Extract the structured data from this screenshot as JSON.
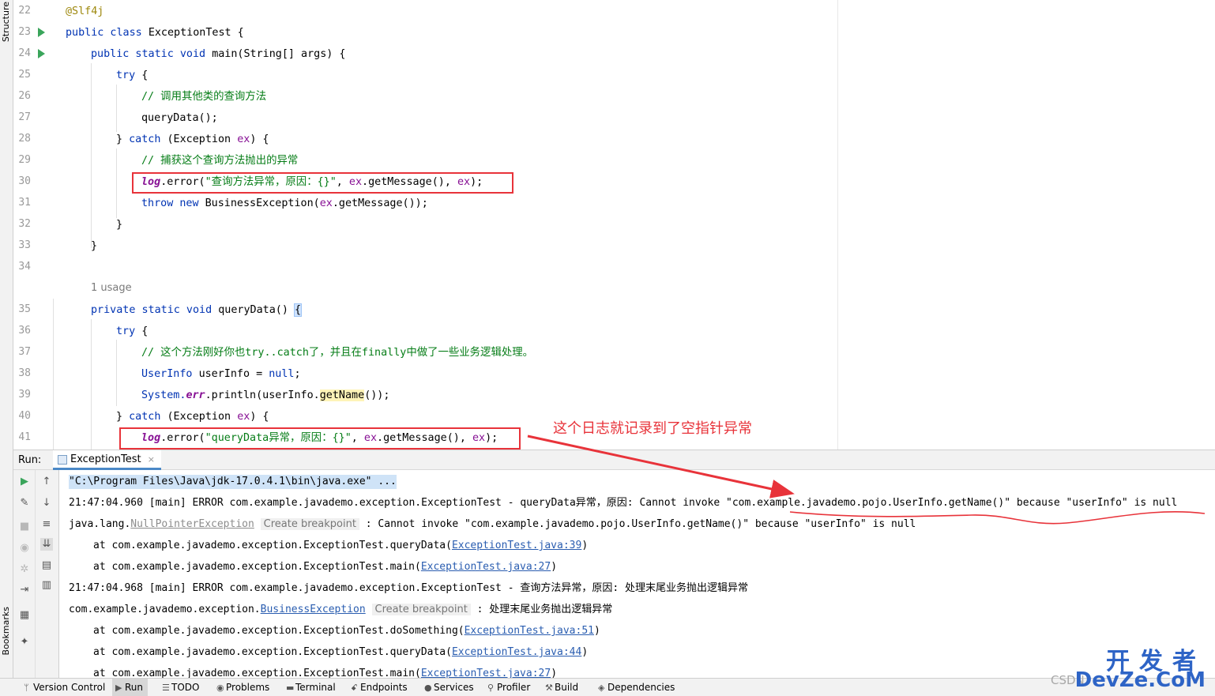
{
  "side_labels": {
    "structure": "Structure",
    "bookmarks": "Bookmarks"
  },
  "editor": {
    "line_numbers": [
      "22",
      "23",
      "24",
      "25",
      "26",
      "27",
      "28",
      "29",
      "30",
      "31",
      "32",
      "33",
      "34",
      "35",
      "36",
      "37",
      "38",
      "39",
      "40",
      "41"
    ],
    "usage_hint": "1 usage",
    "code": {
      "l22_annotation": "@Slf4j",
      "l23_kw": "public class ",
      "l23_name": "ExceptionTest {",
      "l24_kw": "public static void ",
      "l24_rest": "main(String[] args) {",
      "l25_kw": "try",
      "l25_rest": " {",
      "l26_comment": "// 调用其他类的查询方法",
      "l27": "queryData();",
      "l28_a": "} ",
      "l28_kw": "catch",
      "l28_b": " (Exception ",
      "l28_param": "ex",
      "l28_c": ") {",
      "l29_comment": "// 捕获这个查询方法抛出的异常",
      "l30_log": "log",
      "l30_a": ".error(",
      "l30_str": "\"查询方法异常，原因：{}\"",
      "l30_b": ", ",
      "l30_ex1": "ex",
      "l30_c": ".getMessage(), ",
      "l30_ex2": "ex",
      "l30_d": ");",
      "l31_kw": "throw new ",
      "l31_a": "BusinessException(",
      "l31_ex": "ex",
      "l31_b": ".getMessage());",
      "l32": "}",
      "l33": "}",
      "l35_kw": "private static void ",
      "l35_rest": "queryData() ",
      "l35_brace": "{",
      "l36_kw": "try",
      "l36_rest": " {",
      "l37_comment": "// 这个方法刚好你也try..catch了，并且在finally中做了一些业务逻辑处理。",
      "l38_type": "UserInfo ",
      "l38_var": "userInfo = ",
      "l38_null": "null",
      "l38_end": ";",
      "l39_sys": "System.",
      "l39_err": "err",
      "l39_a": ".println(userInfo.",
      "l39_hl": "getName",
      "l39_b": "());",
      "l40_a": "} ",
      "l40_kw": "catch",
      "l40_b": " (Exception ",
      "l40_param": "ex",
      "l40_c": ") {",
      "l41_log": "log",
      "l41_a": ".error(",
      "l41_str": "\"queryData异常，原因：{}\"",
      "l41_b": ", ",
      "l41_ex1": "ex",
      "l41_c": ".getMessage(), ",
      "l41_ex2": "ex",
      "l41_d": ");"
    }
  },
  "annotation_text": "这个日志就记录到了空指针异常",
  "run_panel": {
    "label": "Run:",
    "tab": "ExceptionTest",
    "tab_close": "×"
  },
  "console": {
    "cmd": "\"C:\\Program Files\\Java\\jdk-17.0.4.1\\bin\\java.exe\" ...",
    "l1": "21:47:04.960 [main] ERROR com.example.javademo.exception.ExceptionTest - queryData异常，原因: Cannot invoke \"com.example.javademo.pojo.UserInfo.getName()\" because \"userInfo\" is null",
    "l2_pre": "java.lang.",
    "l2_link": "NullPointerException",
    "l2_hint": "Create breakpoint",
    "l2_post": " : Cannot invoke \"com.example.javademo.pojo.UserInfo.getName()\" because \"userInfo\" is null",
    "l3_pre": "at com.example.javademo.exception.ExceptionTest.queryData(",
    "l3_link": "ExceptionTest.java:39",
    "l3_post": ")",
    "l4_pre": "at com.example.javademo.exception.ExceptionTest.main(",
    "l4_link": "ExceptionTest.java:27",
    "l4_post": ")",
    "l5": "21:47:04.968 [main] ERROR com.example.javademo.exception.ExceptionTest - 查询方法异常，原因: 处理末尾业务抛出逻辑异常",
    "l6_pre": "com.example.javademo.exception.",
    "l6_link": "BusinessException",
    "l6_hint": "Create breakpoint",
    "l6_post": " : 处理末尾业务抛出逻辑异常",
    "l7_pre": "at com.example.javademo.exception.ExceptionTest.doSomething(",
    "l7_link": "ExceptionTest.java:51",
    "l7_post": ")",
    "l8_pre": "at com.example.javademo.exception.ExceptionTest.queryData(",
    "l8_link": "ExceptionTest.java:44",
    "l8_post": ")",
    "l9_pre": "at com.example.javademo.exception.ExceptionTest.main(",
    "l9_link": "ExceptionTest.java:27",
    "l9_post": ")"
  },
  "status_bar": {
    "version_control": "Version Control",
    "run": "Run",
    "todo": "TODO",
    "problems": "Problems",
    "terminal": "Terminal",
    "endpoints": "Endpoints",
    "services": "Services",
    "profiler": "Profiler",
    "build": "Build",
    "dependencies": "Dependencies"
  },
  "watermark": {
    "top": "开发者",
    "bottom": "DevZe.CoM",
    "csdn": "CSDN"
  },
  "colors": {
    "keyword": "#0033b3",
    "comment": "#067d17",
    "string": "#067d17",
    "annotation_red": "#e8333a",
    "link": "#2a5db0"
  }
}
